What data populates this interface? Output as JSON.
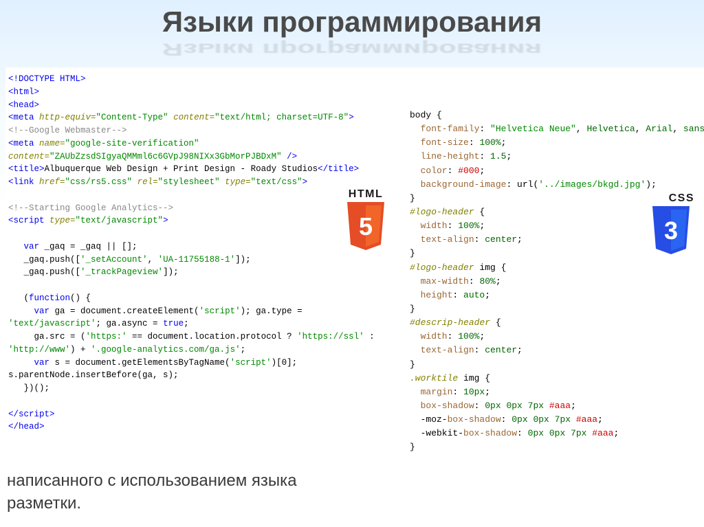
{
  "title": "Языки программирования",
  "html_badge": {
    "label": "HTML",
    "number": "5"
  },
  "css_badge": {
    "label": "CSS",
    "number": "3"
  },
  "html_code": {
    "l1a": "<!DOCTYPE HTML>",
    "l2a": "<html>",
    "l3a": "<head>",
    "l4a": "<meta",
    "l4b": " http-equiv=",
    "l4c": "\"Content-Type\"",
    "l4d": " content=",
    "l4e": "\"text/html; charset=UTF-8\"",
    "l4f": ">",
    "l5a": "<!--Google Webmaster-->",
    "l6a": "<meta",
    "l6b": " name=",
    "l6c": "\"google-site-verification\"",
    "l7a": "content=",
    "l7b": "\"ZAUbZzsdSIgyaQMMml6c6GVpJ98NIXx3GbMorPJBDxM\"",
    "l7c": " />",
    "l8a": "<title>",
    "l8b": "Albuquerque Web Design + Print Design - Roady Studios",
    "l8c": "</title>",
    "l9a": "<link",
    "l9b": " href=",
    "l9c": "\"css/rs5.css\"",
    "l9d": " rel=",
    "l9e": "\"stylesheet\"",
    "l9f": " type=",
    "l9g": "\"text/css\"",
    "l9h": ">",
    "l10a": "<!--Starting Google Analytics-->",
    "l11a": "<script",
    "l11b": " type=",
    "l11c": "\"text/javascript\"",
    "l11d": ">",
    "l12a": "   var",
    "l12b": " _gaq = _gaq || [];",
    "l13a": "   _gaq.push([",
    "l13b": "'_setAccount'",
    "l13c": ", ",
    "l13d": "'UA-11755188-1'",
    "l13e": "]);",
    "l14a": "   _gaq.push([",
    "l14b": "'_trackPageview'",
    "l14c": "]);",
    "l15a": "   (",
    "l15b": "function",
    "l15c": "() {",
    "l16a": "     var",
    "l16b": " ga = document.createElement(",
    "l16c": "'script'",
    "l16d": "); ga.type = ",
    "l17a": "'text/javascript'",
    "l17b": "; ga.async = ",
    "l17c": "true",
    "l17d": ";",
    "l18a": "     ga.src = (",
    "l18b": "'https:'",
    "l18c": " == document.location.protocol ? ",
    "l18d": "'https://ssl'",
    "l18e": " : ",
    "l19a": "'http://www'",
    "l19b": ") + ",
    "l19c": "'.google-analytics.com/ga.js'",
    "l19d": ";",
    "l20a": "     var",
    "l20b": " s = document.getElementsByTagName(",
    "l20c": "'script'",
    "l20d": ")[0];",
    "l21a": "s.parentNode.insertBefore(ga, s);",
    "l22a": "   })();",
    "l23a": "</script>",
    "l24a": "</head>"
  },
  "css_code": {
    "s1": "body {",
    "s2a": "  font-family",
    "s2b": ": ",
    "s2c": "\"Helvetica Neue\"",
    "s2d": ", ",
    "s2e": "Helvetica",
    "s2f": ", ",
    "s2g": "Arial",
    "s2h": ", ",
    "s2i": "sans-",
    "s3a": "  font-size",
    "s3b": ": ",
    "s3c": "100%",
    "s3d": ";",
    "s4a": "  line-height",
    "s4b": ": ",
    "s4c": "1.5",
    "s4d": ";",
    "s5a": "  color",
    "s5b": ": ",
    "s5c": "#000",
    "s5d": ";",
    "s6a": "  background-image",
    "s6b": ": url(",
    "s6c": "'../images/bkgd.jpg'",
    "s6d": ");",
    "s7": "}",
    "s8a": "#logo-header",
    "s8b": " {",
    "s9a": "  width",
    "s9b": ": ",
    "s9c": "100%",
    "s9d": ";",
    "s10a": "  text-align",
    "s10b": ": ",
    "s10c": "center",
    "s10d": ";",
    "s11": "}",
    "s12a": "#logo-header",
    "s12b": " img {",
    "s13a": "  max-width",
    "s13b": ": ",
    "s13c": "80%",
    "s13d": ";",
    "s14a": "  height",
    "s14b": ": ",
    "s14c": "auto",
    "s14d": ";",
    "s15": "}",
    "s16a": "#descrip-header",
    "s16b": " {",
    "s17a": "  width",
    "s17b": ": ",
    "s17c": "100%",
    "s17d": ";",
    "s18a": "  text-align",
    "s18b": ": ",
    "s18c": "center",
    "s18d": ";",
    "s19": "}",
    "s20a": ".worktile",
    "s20b": " img {",
    "s21a": "  margin",
    "s21b": ": ",
    "s21c": "10px",
    "s21d": ";",
    "s22a": "  box-shadow",
    "s22b": ": ",
    "s22c": "0px 0px 7px ",
    "s22d": "#aaa",
    "s22e": ";",
    "s23a": "  -moz-",
    "s23b": "box-shadow",
    "s23c": ": ",
    "s23d": "0px 0px 7px ",
    "s23e": "#aaa",
    "s23f": ";",
    "s24a": "  -webkit-",
    "s24b": "box-shadow",
    "s24c": ": ",
    "s24d": "0px 0px 7px ",
    "s24e": "#aaa",
    "s24f": ";",
    "s25": "}"
  },
  "bottom": {
    "line1": "написанного с использованием языка",
    "line2": "разметки."
  }
}
